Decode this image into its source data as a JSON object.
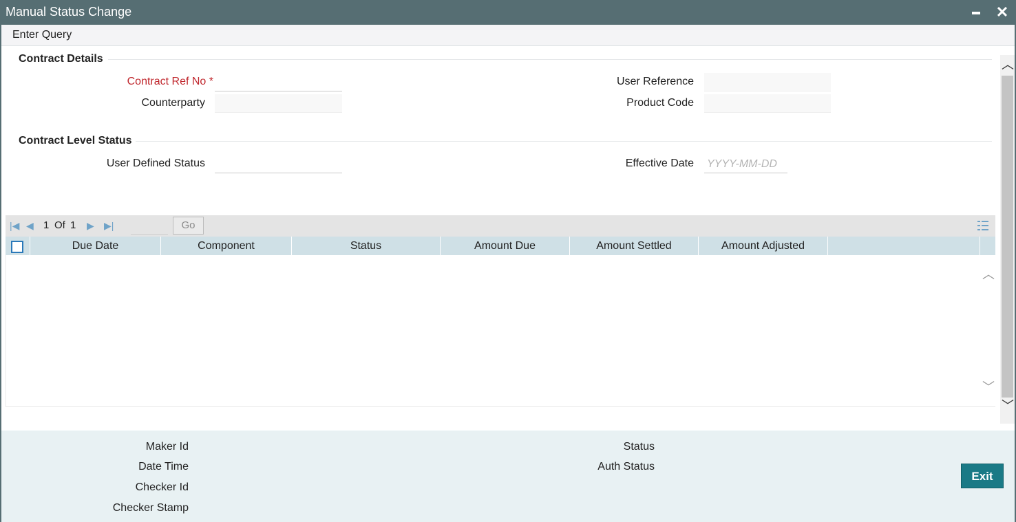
{
  "window": {
    "title": "Manual Status Change",
    "minimize_icon": "minimize-icon",
    "close_icon": "close-icon",
    "close_glyph": "✕"
  },
  "menu": {
    "enter_query": "Enter Query"
  },
  "contract_details": {
    "section_title": "Contract Details",
    "contract_ref_no_label": "Contract Ref No *",
    "contract_ref_no_value": "",
    "counterparty_label": "Counterparty",
    "counterparty_value": "",
    "user_reference_label": "User Reference",
    "user_reference_value": "",
    "product_code_label": "Product Code",
    "product_code_value": ""
  },
  "contract_level_status": {
    "section_title": "Contract Level Status",
    "user_defined_status_label": "User Defined Status",
    "user_defined_status_value": "",
    "effective_date_label": "Effective Date",
    "effective_date_placeholder": "YYYY-MM-DD"
  },
  "grid": {
    "pager": {
      "current_page": "1",
      "of_label": "Of",
      "total_pages": "1",
      "go_label": "Go"
    },
    "columns": [
      "Due Date",
      "Component",
      "Status",
      "Amount Due",
      "Amount Settled",
      "Amount Adjusted"
    ],
    "rows": []
  },
  "footer": {
    "maker_id_label": "Maker Id",
    "date_time_label": "Date Time",
    "checker_id_label": "Checker Id",
    "checker_stamp_label": "Checker Stamp",
    "status_label": "Status",
    "auth_status_label": "Auth Status",
    "exit_label": "Exit"
  },
  "colors": {
    "titlebar": "#566e73",
    "grid_header": "#cfe0e6",
    "footer": "#e8f1f3",
    "required_label": "#c0272d",
    "exit_button": "#1a7a86"
  }
}
